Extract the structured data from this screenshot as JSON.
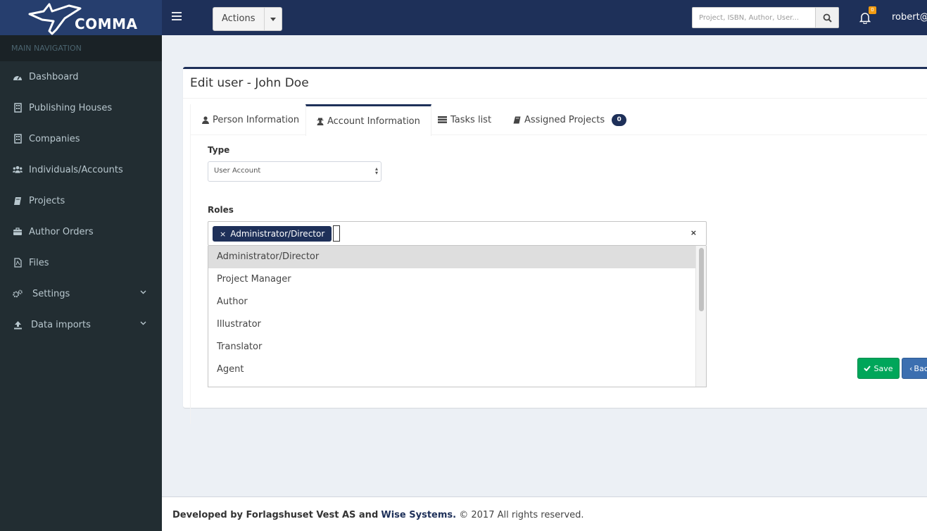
{
  "header": {
    "brand": "COMMA",
    "actions_label": "Actions",
    "search_placeholder": "Project, ISBN, Author, User...",
    "notification_count": "0",
    "user_name": "robert@c"
  },
  "sidebar": {
    "section_label": "MAIN NAVIGATION",
    "items": [
      {
        "label": "Dashboard",
        "icon": "dashboard-icon"
      },
      {
        "label": "Publishing Houses",
        "icon": "building-icon"
      },
      {
        "label": "Companies",
        "icon": "building-icon"
      },
      {
        "label": "Individuals/Accounts",
        "icon": "users-icon"
      },
      {
        "label": "Projects",
        "icon": "book-icon"
      },
      {
        "label": "Author Orders",
        "icon": "briefcase-icon"
      },
      {
        "label": "Files",
        "icon": "file-pdf-icon"
      },
      {
        "label": "Settings",
        "icon": "cogs-icon"
      },
      {
        "label": "Data imports",
        "icon": "upload-icon"
      }
    ]
  },
  "panel": {
    "title": "Edit user - John Doe",
    "tabs": [
      {
        "label": "Person Information"
      },
      {
        "label": "Account Information"
      },
      {
        "label": "Tasks list"
      },
      {
        "label": "Assigned Projects",
        "badge": "0"
      }
    ],
    "type_label": "Type",
    "type_value": "User Account",
    "roles_label": "Roles",
    "selected_role": "Administrator/Director",
    "role_options": [
      "Administrator/Director",
      "Project Manager",
      "Author",
      "Illustrator",
      "Translator",
      "Agent"
    ],
    "save_label": "Save",
    "back_label": "Back"
  },
  "footer": {
    "developed_by": "Developed by Forlagshuset Vest AS and",
    "company_link": "Wise Systems.",
    "rights": "© 2017 All rights reserved."
  },
  "colors": {
    "primary": "#1e3059",
    "sidebar": "#222d32",
    "success": "#00a65a",
    "badge": "#f39c12"
  }
}
